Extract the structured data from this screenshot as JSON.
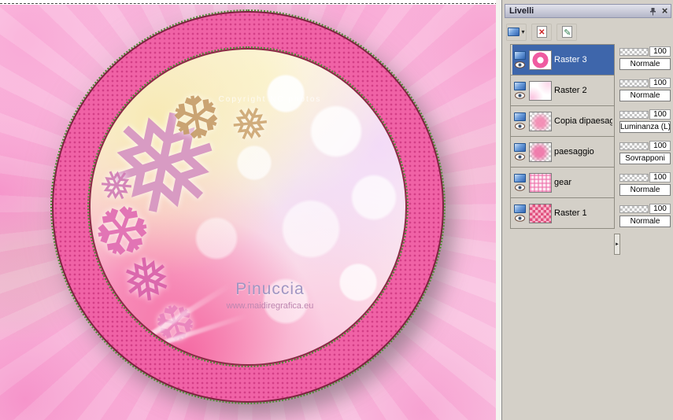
{
  "canvas": {
    "copyright": "Copyright NC photos",
    "watermark_name": "Pinuccia",
    "watermark_site": "www.maidiregrafica.eu",
    "flakes": {
      "big": "❅",
      "gold": "❆",
      "gold2": "❅",
      "f3": "❆",
      "f4": "❅",
      "f5": "❆",
      "f6": "❅"
    }
  },
  "panel": {
    "title": "Livelli",
    "icons": {
      "close": "×",
      "dropdown_arrow": "▾",
      "delete_x": "✕",
      "edit": "✎",
      "splitter": "►"
    },
    "colors": {
      "selected_row": "#3e66ab",
      "panel_bg": "#d4d0c8",
      "ring_pink": "#f062a6"
    },
    "layers": [
      {
        "name": "Raster 3",
        "opacity": "100",
        "blend": "Normale"
      },
      {
        "name": "Raster 2",
        "opacity": "100",
        "blend": "Normale"
      },
      {
        "name": "Copia dipaesaggio",
        "opacity": "100",
        "blend": "Luminanza (L)"
      },
      {
        "name": "paesaggio",
        "opacity": "100",
        "blend": "Sovrapponi"
      },
      {
        "name": "gear",
        "opacity": "100",
        "blend": "Normale"
      },
      {
        "name": "Raster 1",
        "opacity": "100",
        "blend": "Normale"
      }
    ]
  }
}
